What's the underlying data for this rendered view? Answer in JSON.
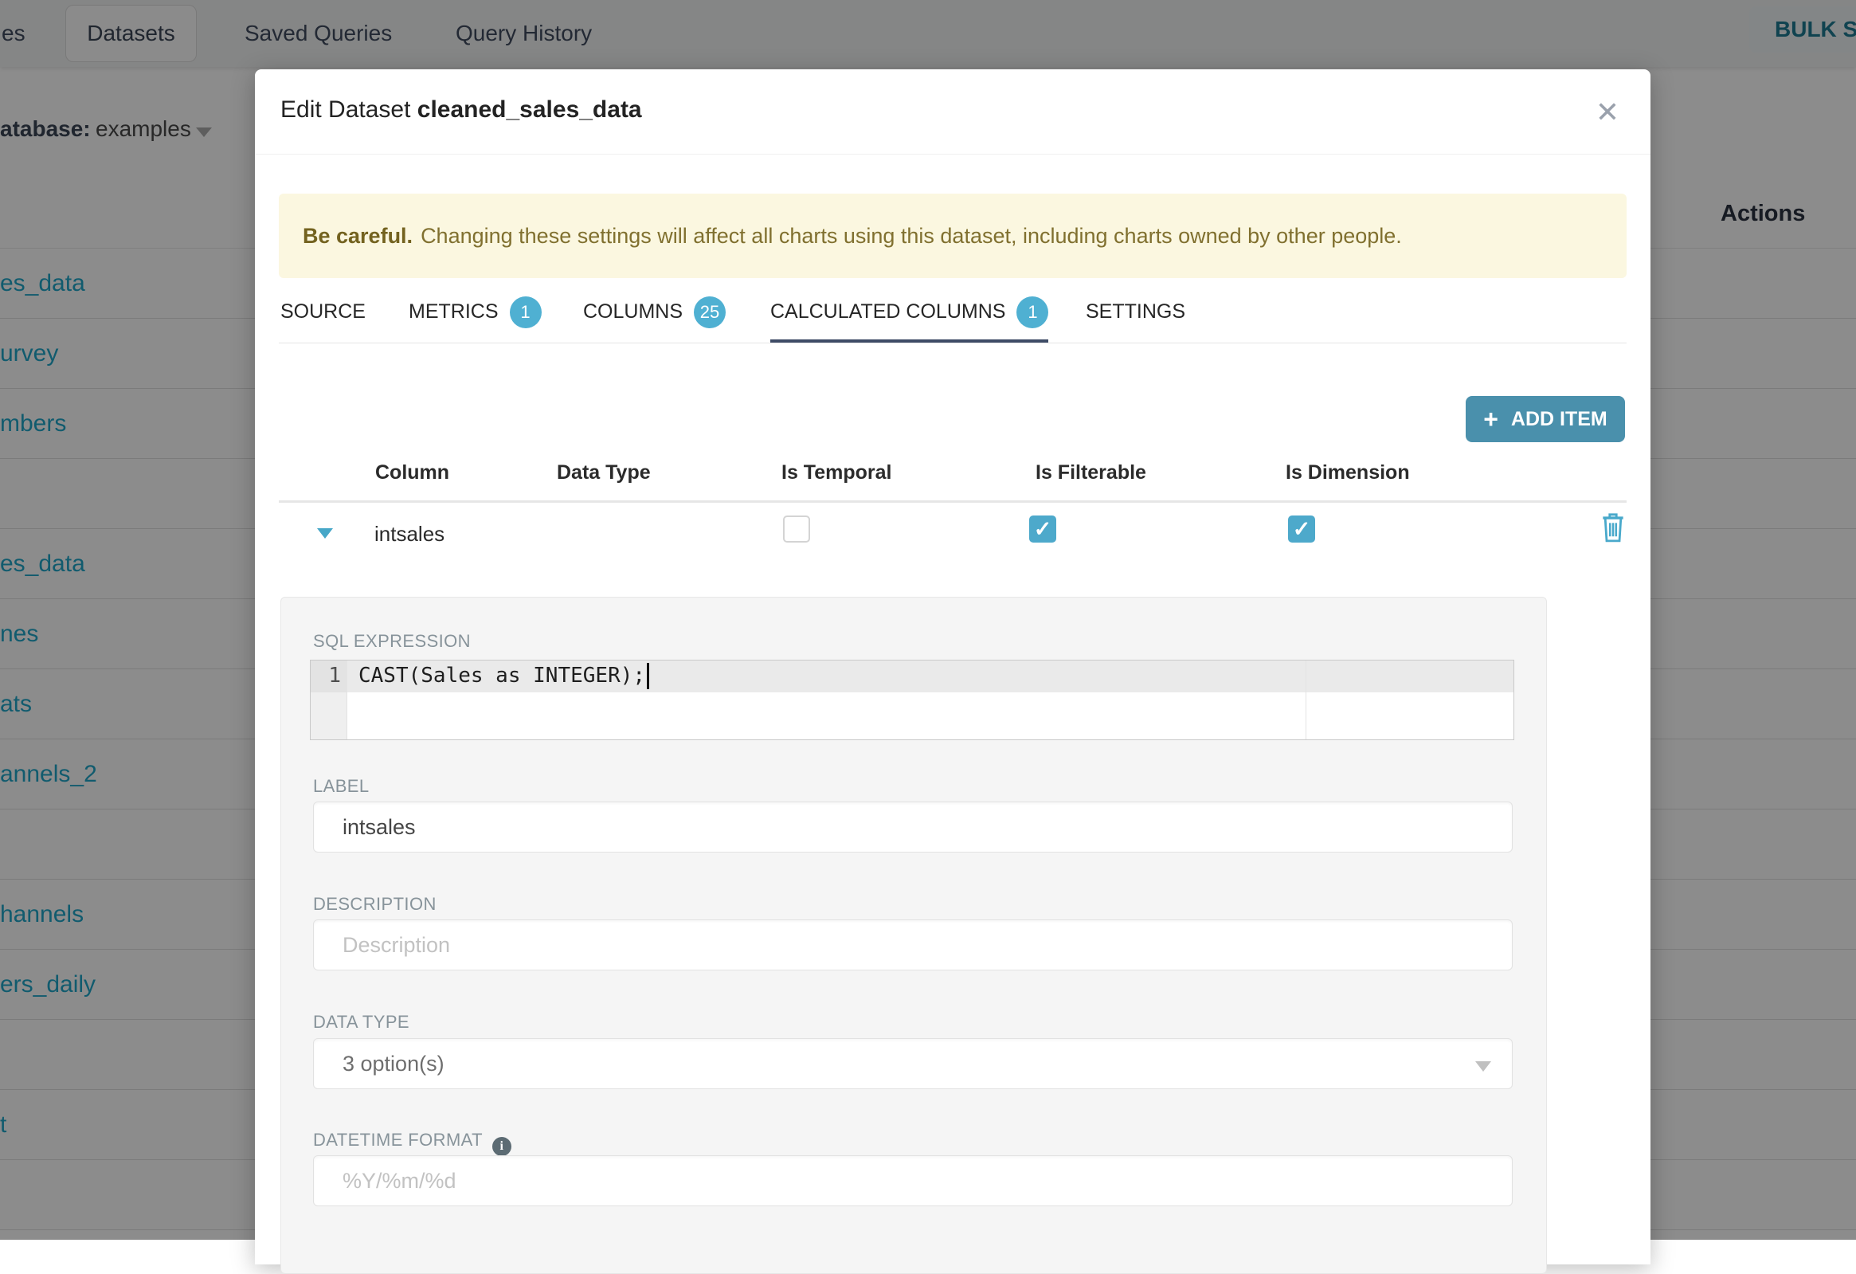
{
  "background": {
    "nav": {
      "left_fragment": "es",
      "datasets_tab": "Datasets",
      "saved_queries_tab": "Saved Queries",
      "query_history_tab": "Query History",
      "bulk_select_label": "BULK SELE"
    },
    "filter": {
      "database_label": "atabase:",
      "database_value": "examples"
    },
    "table": {
      "actions_header": "Actions",
      "rows": [
        "es_data",
        "urvey",
        "mbers",
        "",
        "es_data",
        "nes",
        "ats",
        "annels_2",
        "",
        "hannels",
        "ers_daily",
        "",
        "t",
        ""
      ]
    }
  },
  "modal": {
    "title_prefix": "Edit Dataset ",
    "title_name": "cleaned_sales_data",
    "close_glyph": "✕",
    "warning_bold": "Be careful.",
    "warning_text": "Changing these settings will affect all charts using this dataset, including charts owned by other people.",
    "tabs": [
      {
        "label": "SOURCE"
      },
      {
        "label": "METRICS",
        "badge": "1"
      },
      {
        "label": "COLUMNS",
        "badge": "25"
      },
      {
        "label": "CALCULATED COLUMNS",
        "badge": "1",
        "active": true
      },
      {
        "label": "SETTINGS"
      }
    ],
    "add_item": {
      "plus": "+",
      "label": "ADD ITEM"
    },
    "columns_table": {
      "headers": [
        "Column",
        "Data Type",
        "Is Temporal",
        "Is Filterable",
        "Is Dimension"
      ],
      "row": {
        "name": "intsales",
        "is_temporal": false,
        "is_filterable": true,
        "is_dimension": true,
        "check_glyph": "✓"
      }
    },
    "editor": {
      "section_label": "SQL EXPRESSION",
      "line_number": "1",
      "code": "CAST(Sales as INTEGER);"
    },
    "fields": {
      "label": {
        "label": "LABEL",
        "value": "intsales"
      },
      "description": {
        "label": "DESCRIPTION",
        "placeholder": "Description"
      },
      "data_type": {
        "label": "DATA TYPE",
        "value": "3 option(s)"
      },
      "datetime_format": {
        "label": "DATETIME FORMAT",
        "info_glyph": "i",
        "placeholder": "%Y/%m/%d"
      }
    }
  },
  "colors": {
    "accent_link": "#20A7C9",
    "checkbox": "#4DA9CB",
    "badge": "#4FB0D2",
    "add_button": "#4A90AC",
    "tab_underline": "#3E4B66",
    "warning_bg": "#FBF7E0",
    "warning_text": "#80702F"
  }
}
